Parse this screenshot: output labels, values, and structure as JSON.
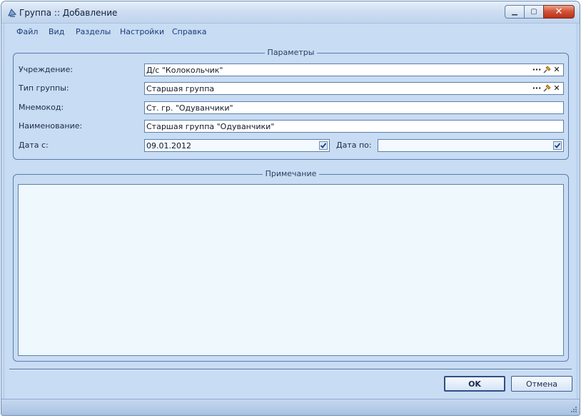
{
  "window": {
    "title": "Группа :: Добавление",
    "icons": {
      "app": "group-app-icon",
      "minimize": "minimize-icon",
      "maximize": "maximize-icon",
      "close": "close-icon"
    }
  },
  "menu": [
    "Файл",
    "Вид",
    "Разделы",
    "Настройки",
    "Справка"
  ],
  "params": {
    "legend": "Параметры",
    "institution": {
      "label": "Учреждение:",
      "value": "Д/с \"Колокольчик\""
    },
    "group_type": {
      "label": "Тип группы:",
      "value": "Старшая группа"
    },
    "mnemocode": {
      "label": "Мнемокод:",
      "value": "Ст. гр. \"Одуванчики\""
    },
    "name": {
      "label": "Наименование:",
      "value": "Старшая группа \"Одуванчики\""
    },
    "date_from": {
      "label": "Дата с:",
      "value": "09.01.2012",
      "checked": true
    },
    "date_to": {
      "label": "Дата по:",
      "value": "",
      "checked": true
    },
    "lookup_button": "···",
    "clear_button": "✕"
  },
  "note": {
    "legend": "Примечание",
    "value": ""
  },
  "buttons": {
    "ok": "OK",
    "cancel": "Отмена"
  },
  "colors": {
    "accent": "#5b7bb0",
    "window_bg": "#c8dcf3",
    "close_red": "#c4412a"
  }
}
